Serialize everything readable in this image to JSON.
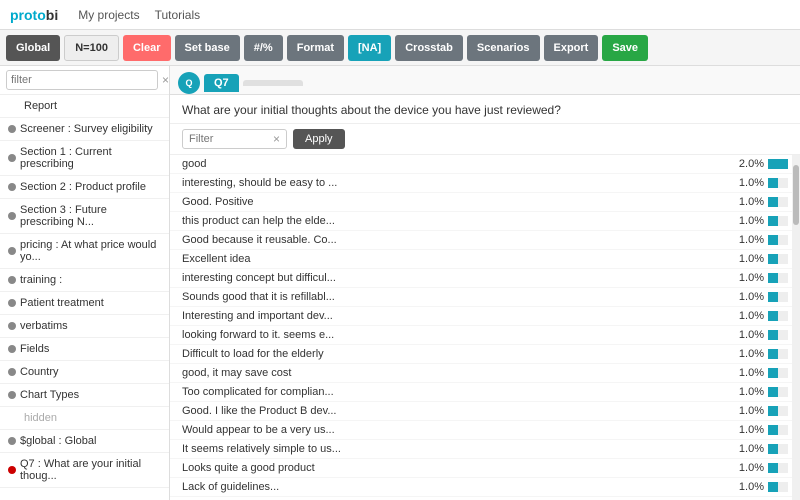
{
  "nav": {
    "logo_proto": "proto",
    "logo_bi": "bi",
    "links": [
      "My projects",
      "Tutorials"
    ]
  },
  "toolbar": {
    "global_label": "Global",
    "n100_label": "N=100",
    "clear_label": "Clear",
    "setbase_label": "Set base",
    "hash_label": "#/%",
    "format_label": "Format",
    "na_label": "[NA]",
    "crosstab_label": "Crosstab",
    "scenarios_label": "Scenarios",
    "export_label": "Export",
    "save_label": "Save"
  },
  "sidebar": {
    "filter_placeholder": "filter",
    "items": [
      {
        "label": "Report",
        "dot_color": ""
      },
      {
        "label": "Screener : Survey eligibility",
        "dot_color": "#888"
      },
      {
        "label": "Section 1 : Current prescribing",
        "dot_color": "#888"
      },
      {
        "label": "Section 2 : Product profile",
        "dot_color": "#888"
      },
      {
        "label": "Section 3 : Future prescribing N...",
        "dot_color": "#888"
      },
      {
        "label": "pricing : At what price would yo...",
        "dot_color": "#888"
      },
      {
        "label": "training :",
        "dot_color": "#888"
      },
      {
        "label": "Patient treatment",
        "dot_color": "#888"
      },
      {
        "label": "verbatims",
        "dot_color": "#888"
      },
      {
        "label": "Fields",
        "dot_color": "#888"
      },
      {
        "label": "Country",
        "dot_color": "#888"
      },
      {
        "label": "Chart Types",
        "dot_color": "#888"
      },
      {
        "label": "hidden",
        "dot_color": "",
        "muted": true
      },
      {
        "label": "$global : Global",
        "dot_color": "#888"
      },
      {
        "label": "Q7 : What are your initial thoug...",
        "dot_color": "#cc0000"
      }
    ]
  },
  "content": {
    "q_tab": "Q7",
    "q_avatar_text": "Q",
    "question": "What are your initial thoughts about the device you have just reviewed?",
    "filter_placeholder": "Filter",
    "apply_label": "Apply",
    "responses": [
      {
        "text": "good",
        "pct": "2.0%",
        "bar": 2
      },
      {
        "text": "interesting, should be easy to ...",
        "pct": "1.0%",
        "bar": 1
      },
      {
        "text": "Good. Positive",
        "pct": "1.0%",
        "bar": 1
      },
      {
        "text": "this product can help the elde...",
        "pct": "1.0%",
        "bar": 1
      },
      {
        "text": "Good because it reusable. Co...",
        "pct": "1.0%",
        "bar": 1
      },
      {
        "text": "Excellent idea",
        "pct": "1.0%",
        "bar": 1
      },
      {
        "text": "interesting concept but difficul...",
        "pct": "1.0%",
        "bar": 1
      },
      {
        "text": "Sounds good that it is refillabl...",
        "pct": "1.0%",
        "bar": 1
      },
      {
        "text": "Interesting and important dev...",
        "pct": "1.0%",
        "bar": 1
      },
      {
        "text": "looking forward to it. seems e...",
        "pct": "1.0%",
        "bar": 1
      },
      {
        "text": "Difficult to load for the elderly",
        "pct": "1.0%",
        "bar": 1
      },
      {
        "text": "good, it may save cost",
        "pct": "1.0%",
        "bar": 1
      },
      {
        "text": "Too complicated for complian...",
        "pct": "1.0%",
        "bar": 1
      },
      {
        "text": "Good. I like the Product B dev...",
        "pct": "1.0%",
        "bar": 1
      },
      {
        "text": "Would appear to be a very us...",
        "pct": "1.0%",
        "bar": 1
      },
      {
        "text": "It seems relatively simple to us...",
        "pct": "1.0%",
        "bar": 1
      },
      {
        "text": "Looks quite a good product",
        "pct": "1.0%",
        "bar": 1
      },
      {
        "text": "Lack of guidelines...",
        "pct": "1.0%",
        "bar": 1
      }
    ]
  }
}
